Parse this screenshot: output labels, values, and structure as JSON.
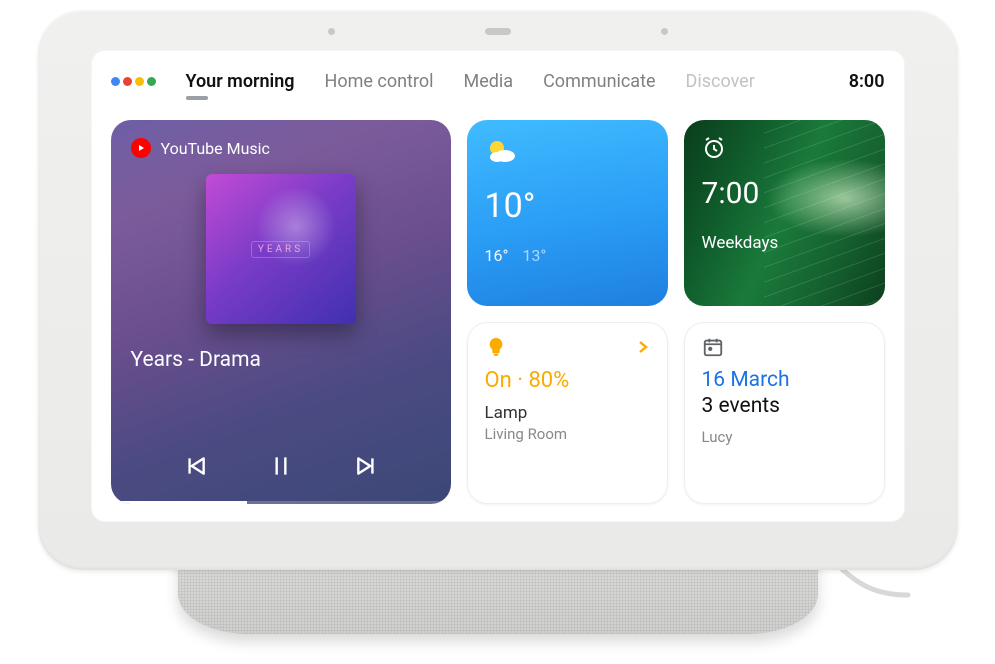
{
  "tabs": {
    "items": [
      "Your morning",
      "Home control",
      "Media",
      "Communicate",
      "Discover"
    ],
    "activeIndex": 0,
    "dimIndex": 4
  },
  "clock": "8:00",
  "music": {
    "provider": "YouTube Music",
    "album_stamp": "YEARS",
    "track": "Years - Drama"
  },
  "weather": {
    "temp": "10°",
    "high": "16°",
    "low": "13°"
  },
  "alarm": {
    "time": "7:00",
    "days": "Weekdays"
  },
  "lamp": {
    "state": "On · 80%",
    "name": "Lamp",
    "room": "Living Room"
  },
  "calendar": {
    "date": "16 March",
    "events": "3 events",
    "owner": "Lucy"
  }
}
